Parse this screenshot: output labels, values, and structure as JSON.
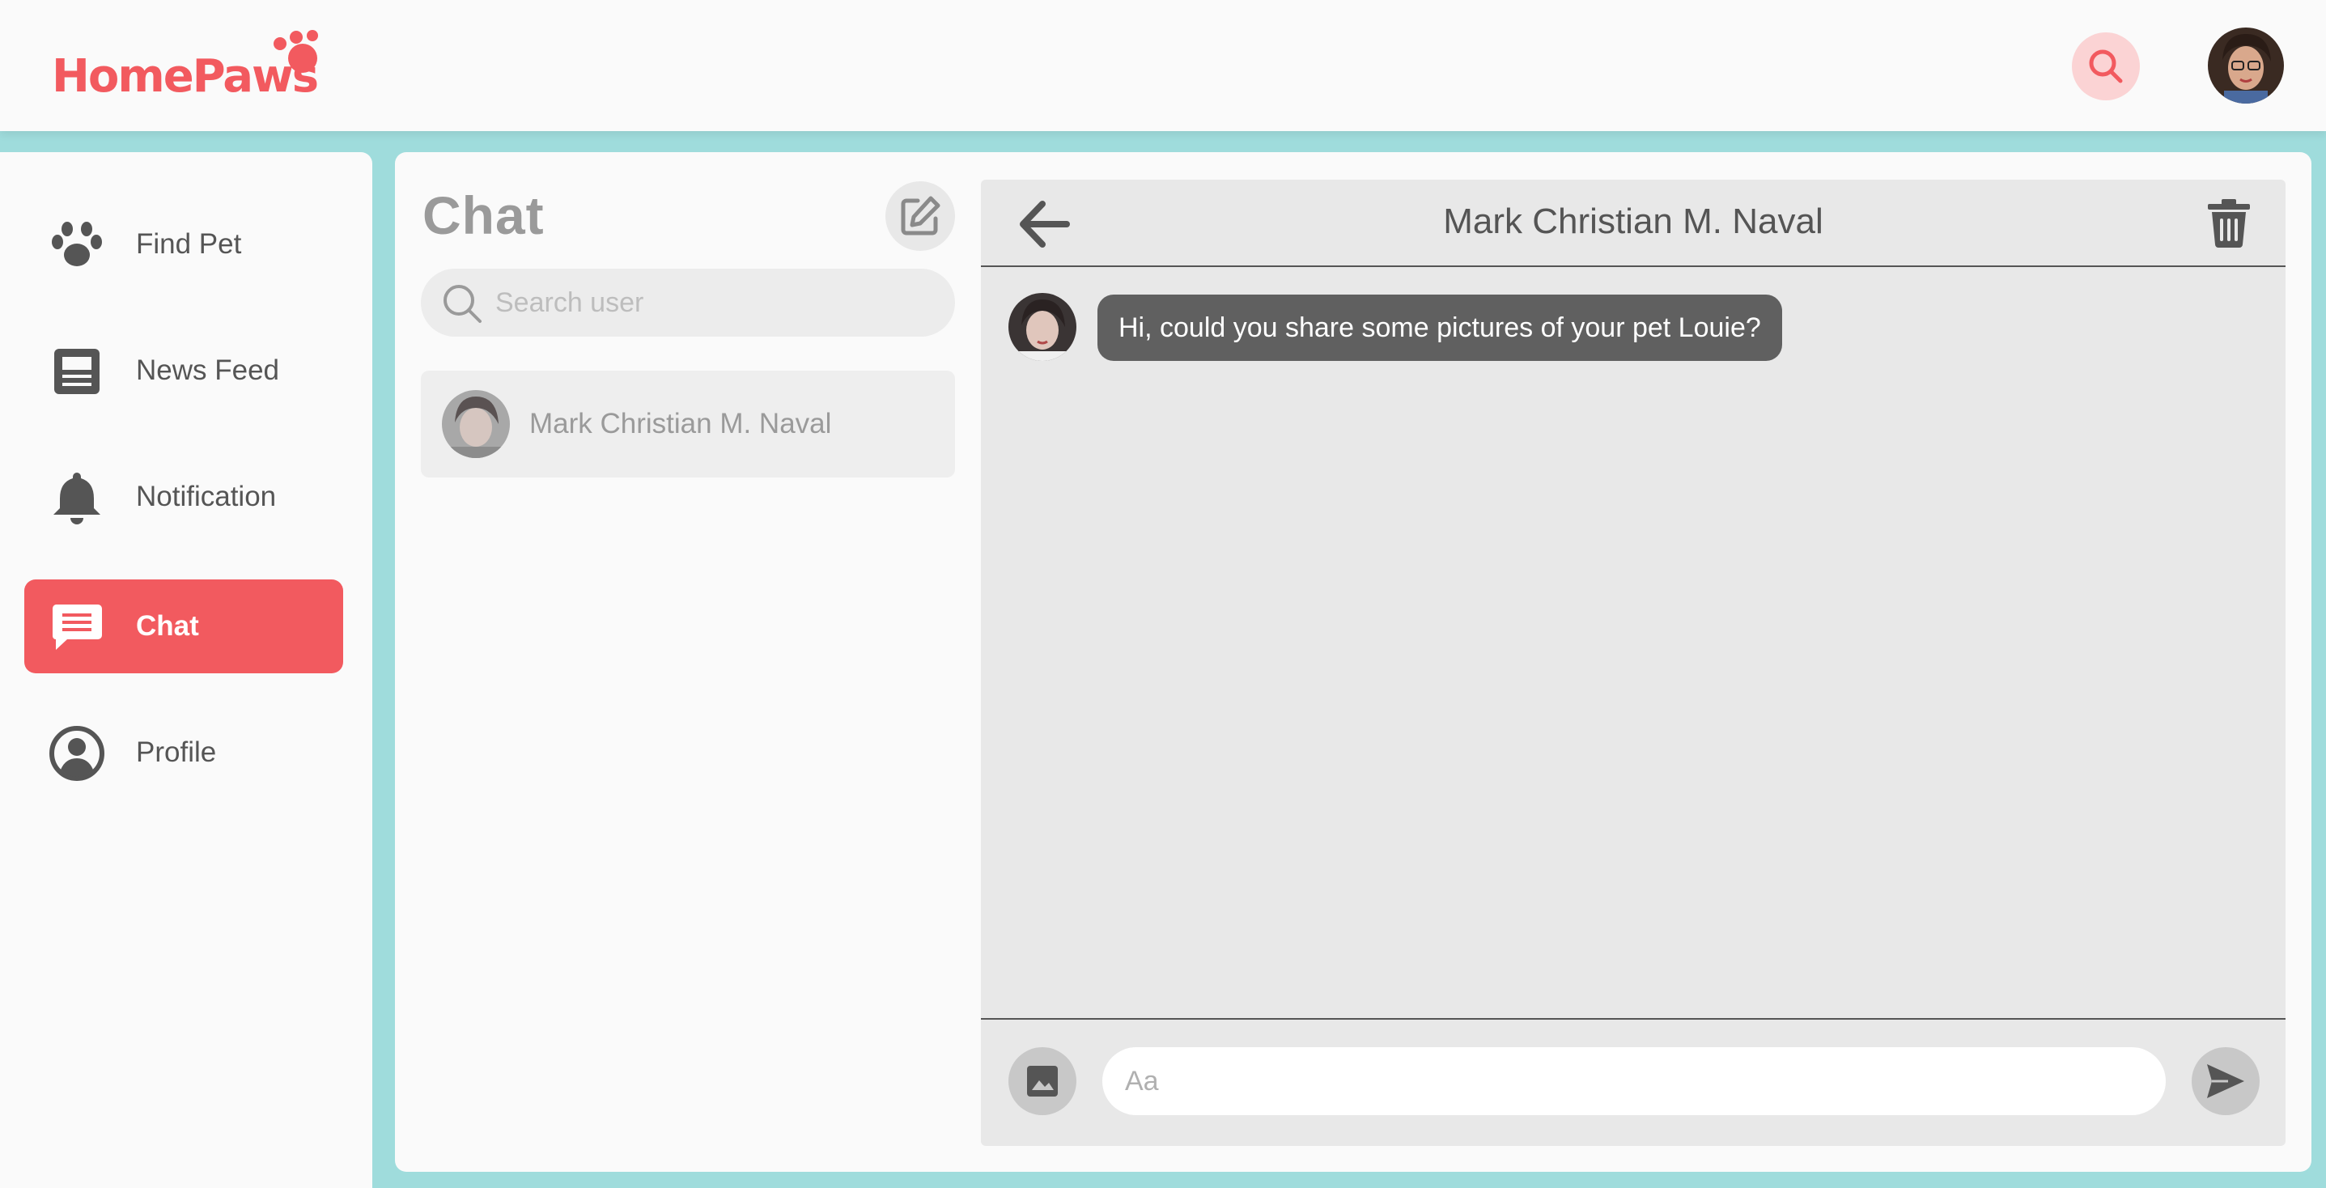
{
  "app": {
    "logo_home": "Home",
    "logo_paws": "Paws",
    "brand_color": "#f25a5f",
    "accent_bg": "#9fdcdc"
  },
  "header": {
    "search_icon": "search-icon",
    "avatar": "user-avatar"
  },
  "sidebar": {
    "items": [
      {
        "label": "Find Pet",
        "icon": "paw-icon",
        "active": false
      },
      {
        "label": "News Feed",
        "icon": "newspaper-icon",
        "active": false
      },
      {
        "label": "Notification",
        "icon": "bell-icon",
        "active": false
      },
      {
        "label": "Chat",
        "icon": "chat-icon",
        "active": true
      },
      {
        "label": "Profile",
        "icon": "user-circle-icon",
        "active": false
      }
    ]
  },
  "chat_list": {
    "title": "Chat",
    "search_placeholder": "Search user",
    "contacts": [
      {
        "name": "Mark Christian M. Naval"
      }
    ]
  },
  "conversation": {
    "contact_name": "Mark Christian M. Naval",
    "messages": [
      {
        "text": "Hi, could you share some pictures of your pet Louie?",
        "from": "contact"
      }
    ],
    "input_placeholder": "Aa"
  }
}
